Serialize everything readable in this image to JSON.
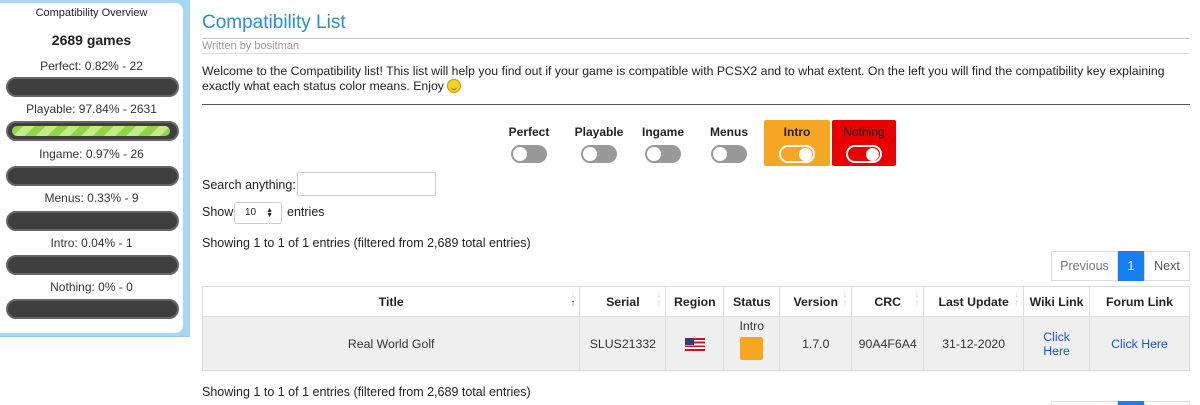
{
  "sidebar": {
    "title": "Compatibility Overview",
    "total": "2689 games",
    "stats": [
      {
        "label": "Perfect: 0.82% - 22",
        "fill_fraction": 0.0082
      },
      {
        "label": "Playable: 97.84% - 2631",
        "fill_fraction": 0.9784
      },
      {
        "label": "Ingame: 0.97% - 26",
        "fill_fraction": 0.0097
      },
      {
        "label": "Menus: 0.33% - 9",
        "fill_fraction": 0.0033
      },
      {
        "label": "Intro: 0.04% - 1",
        "fill_fraction": 0.0004
      },
      {
        "label": "Nothing: 0% - 0",
        "fill_fraction": 0
      }
    ]
  },
  "header": {
    "title": "Compatibility List",
    "byline": "Written by bositman",
    "intro": "Welcome to the Compatibility list! This list will help you find out if your game is compatible with PCSX2 and to what extent. On the left you will find the compatibility key explaining exactly what each status color means. Enjoy"
  },
  "filters": [
    {
      "label": "Perfect",
      "on": false
    },
    {
      "label": "Playable",
      "on": false
    },
    {
      "label": "Ingame",
      "on": false
    },
    {
      "label": "Menus",
      "on": false
    },
    {
      "label": "Intro",
      "on": true,
      "color": "#f5a623"
    },
    {
      "label": "Nothing",
      "on": true,
      "color": "#e60000"
    }
  ],
  "search": {
    "label": "Search anything:",
    "value": "",
    "placeholder": ""
  },
  "length": {
    "show_label": "Show",
    "value": "10",
    "entries_label": "entries"
  },
  "info": {
    "top": "Showing 1 to 1 of 1 entries (filtered from 2,689 total entries)",
    "bottom": "Showing 1 to 1 of 1 entries (filtered from 2,689 total entries)"
  },
  "pagination": {
    "previous": "Previous",
    "current": "1",
    "next": "Next",
    "accent": "#1a7ef2"
  },
  "table": {
    "columns": [
      "Title",
      "Serial",
      "Region",
      "Status",
      "Version",
      "CRC",
      "Last Update",
      "Wiki Link",
      "Forum Link"
    ],
    "rows": [
      {
        "title": "Real World Golf",
        "serial": "SLUS21332",
        "region": "us-flag-icon",
        "status": "Intro",
        "status_color": "#f5a623",
        "version": "1.7.0",
        "crc": "90A4F6A4",
        "last_update": "31-12-2020",
        "wiki_link": "Click Here",
        "forum_link": "Click Here"
      }
    ]
  }
}
